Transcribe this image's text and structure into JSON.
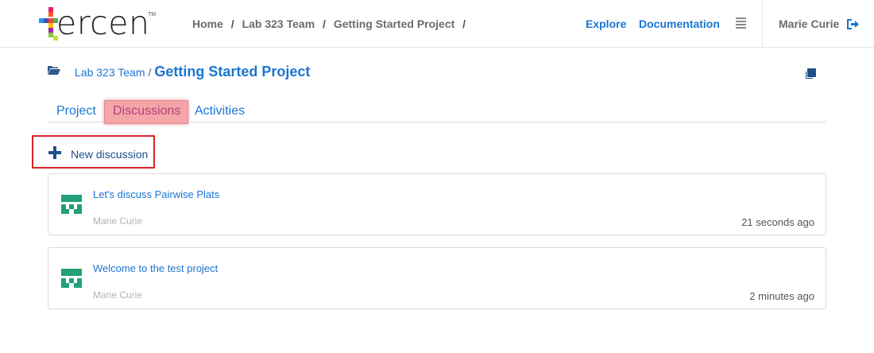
{
  "brand": {
    "logo_text": "ercen",
    "tm": "TM"
  },
  "topnav": {
    "breadcrumb": [
      "Home",
      "Lab 323 Team",
      "Getting Started Project"
    ],
    "separator": "/",
    "explore_label": "Explore",
    "documentation_label": "Documentation",
    "user_name": "Marie Curie"
  },
  "project": {
    "team": "Lab 323 Team",
    "separator": "/",
    "title": "Getting Started Project"
  },
  "tabs": [
    {
      "label": "Project"
    },
    {
      "label": "Discussions",
      "active": true
    },
    {
      "label": "Activities"
    }
  ],
  "new_discussion_label": "New discussion",
  "discussions": [
    {
      "title": "Let's discuss Pairwise Plats",
      "author": "Marie Curie",
      "time": "21 seconds ago"
    },
    {
      "title": "Welcome to the test project",
      "author": "Marie Curie",
      "time": "2 minutes ago"
    }
  ],
  "colors": {
    "link": "#1a75d2",
    "highlight": "#d9252a",
    "avatar": "#22a07a"
  }
}
